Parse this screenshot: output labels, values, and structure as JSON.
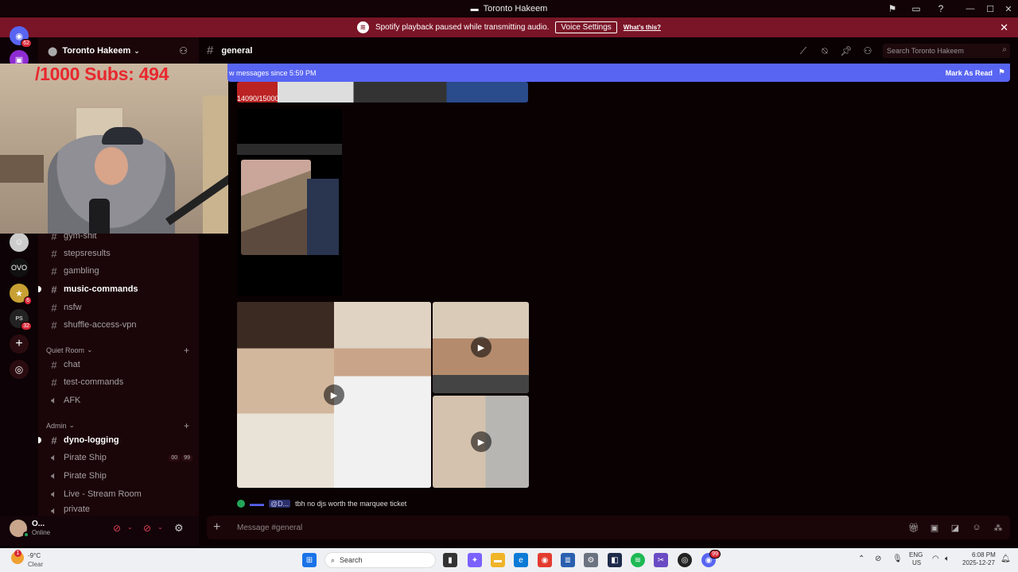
{
  "window": {
    "title": "Toronto Hakeem"
  },
  "banner": {
    "message": "Spotify playback paused while transmitting audio.",
    "button": "Voice Settings",
    "link": "What's this?"
  },
  "rail": {
    "home_badge": "62",
    "badges": [
      "6",
      "32"
    ]
  },
  "server": {
    "name": "Toronto Hakeem"
  },
  "channels": {
    "top": [
      {
        "name": "gym-shit",
        "type": "text",
        "bold": false
      },
      {
        "name": "stepsresults",
        "type": "text",
        "bold": false
      },
      {
        "name": "gambling",
        "type": "text",
        "bold": false
      },
      {
        "name": "music-commands",
        "type": "text",
        "bold": true
      },
      {
        "name": "nsfw",
        "type": "text",
        "bold": false
      },
      {
        "name": "shuffle-access-vpn",
        "type": "text",
        "bold": false
      }
    ],
    "quiet_room": {
      "label": "Quiet Room",
      "items": [
        {
          "name": "chat",
          "type": "text"
        },
        {
          "name": "test-commands",
          "type": "text"
        },
        {
          "name": "AFK",
          "type": "voice"
        }
      ]
    },
    "admin": {
      "label": "Admin",
      "items": [
        {
          "name": "dyno-logging",
          "type": "text",
          "bold": true
        },
        {
          "name": "Pirate Ship",
          "type": "voice",
          "count_a": "00",
          "count_b": "99"
        },
        {
          "name": "Pirate Ship",
          "type": "voice"
        },
        {
          "name": "Live - Stream Room",
          "type": "voice"
        },
        {
          "name": "private",
          "type": "voice"
        }
      ]
    }
  },
  "overlay": {
    "subs": "/1000  Subs: 494"
  },
  "user": {
    "name": "O...",
    "status": "Online"
  },
  "channel": {
    "name": "general"
  },
  "header": {
    "search_placeholder": "Search Toronto Hakeem"
  },
  "new_messages": {
    "text": "w messages since 5:59 PM",
    "mark_read": "Mark As Read"
  },
  "messages": {
    "counter": "14090/15000",
    "last_message": {
      "mention": "@D...",
      "text": "tbh no djs worth the marquee ticket"
    }
  },
  "composer": {
    "placeholder": "Message #general"
  },
  "taskbar": {
    "weather_temp": "-9°C",
    "weather_desc": "Clear",
    "weather_badge": "1",
    "search": "Search",
    "lang_top": "ENG",
    "lang_bottom": "US",
    "time": "6:08 PM",
    "date": "2025-12-27",
    "discord_badge": "99"
  },
  "colors": {
    "accent": "#5865f2",
    "banner": "#7a1427",
    "background": "#0a0103",
    "sidebar": "#1a0508",
    "alert": "#d82737"
  }
}
